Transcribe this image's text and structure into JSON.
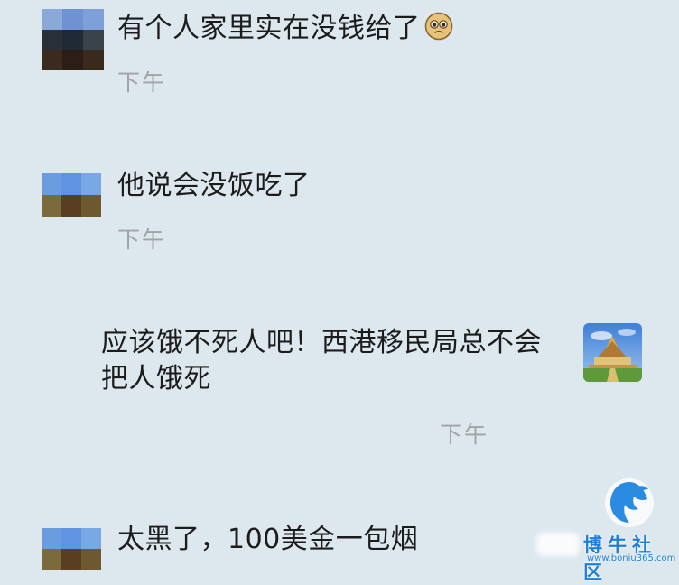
{
  "chat": {
    "messages": [
      {
        "sender": "other",
        "text": "有个人家里实在没钱给了",
        "emoji": "pleading-face-emoji",
        "time": "下午"
      },
      {
        "sender": "other",
        "text": "他说会没饭吃了",
        "time": "下午"
      },
      {
        "sender": "self",
        "line1": "应该饿不死人吧！西港移民局总不会",
        "line2": "把人饿死",
        "time": "下午"
      },
      {
        "sender": "other",
        "text": "太黑了，100美金一包烟"
      }
    ]
  },
  "watermark": {
    "name": "博牛社区",
    "url": "www.boniu365.com",
    "color": "#1e7fd8"
  },
  "colors": {
    "background": "#dde7ee",
    "text": "#1c1c1c",
    "time": "#a0a4a8"
  }
}
